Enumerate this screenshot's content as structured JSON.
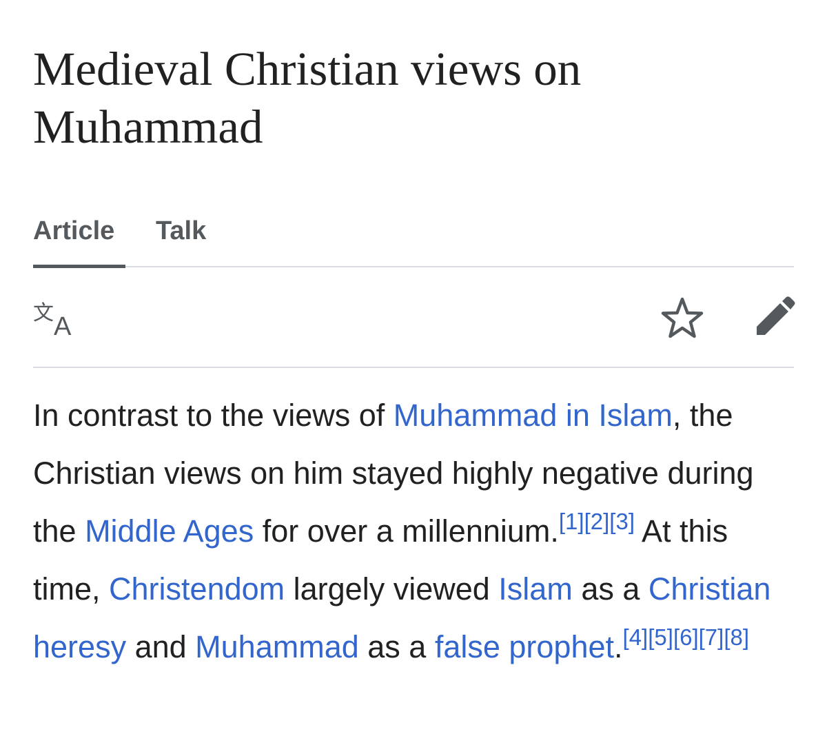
{
  "article": {
    "title": "Medieval Christian views on Muhammad"
  },
  "tabs": [
    {
      "label": "Article",
      "active": true
    },
    {
      "label": "Talk",
      "active": false
    }
  ],
  "toolbar": {
    "icons": [
      "language-icon",
      "star-icon",
      "edit-pencil-icon"
    ]
  },
  "colors": {
    "text": "#202122",
    "link": "#3366cc",
    "tab": "#54595d",
    "divider": "#dadde3"
  },
  "paragraph": {
    "t1": "In contrast to the views of ",
    "link_muhammad_in_islam": "Muhammad in Islam",
    "t2": ", the Christian views on him stayed highly negative during the ",
    "link_middle_ages": "Middle Ages",
    "t3": " for over a millennium.",
    "refs_a": [
      "[1]",
      "[2]",
      "[3]"
    ],
    "t4": " At this time, ",
    "link_christendom": "Christendom",
    "t5": " largely viewed ",
    "link_islam": "Islam",
    "t6": " as a ",
    "link_christian_heresy": "Christian heresy",
    "t7": " and ",
    "link_muhammad": "Muhammad",
    "t8": " as a ",
    "link_false_prophet": "false prophet",
    "t9": ".",
    "refs_b": [
      "[4]",
      "[5]",
      "[6]",
      "[7]",
      "[8]"
    ]
  }
}
